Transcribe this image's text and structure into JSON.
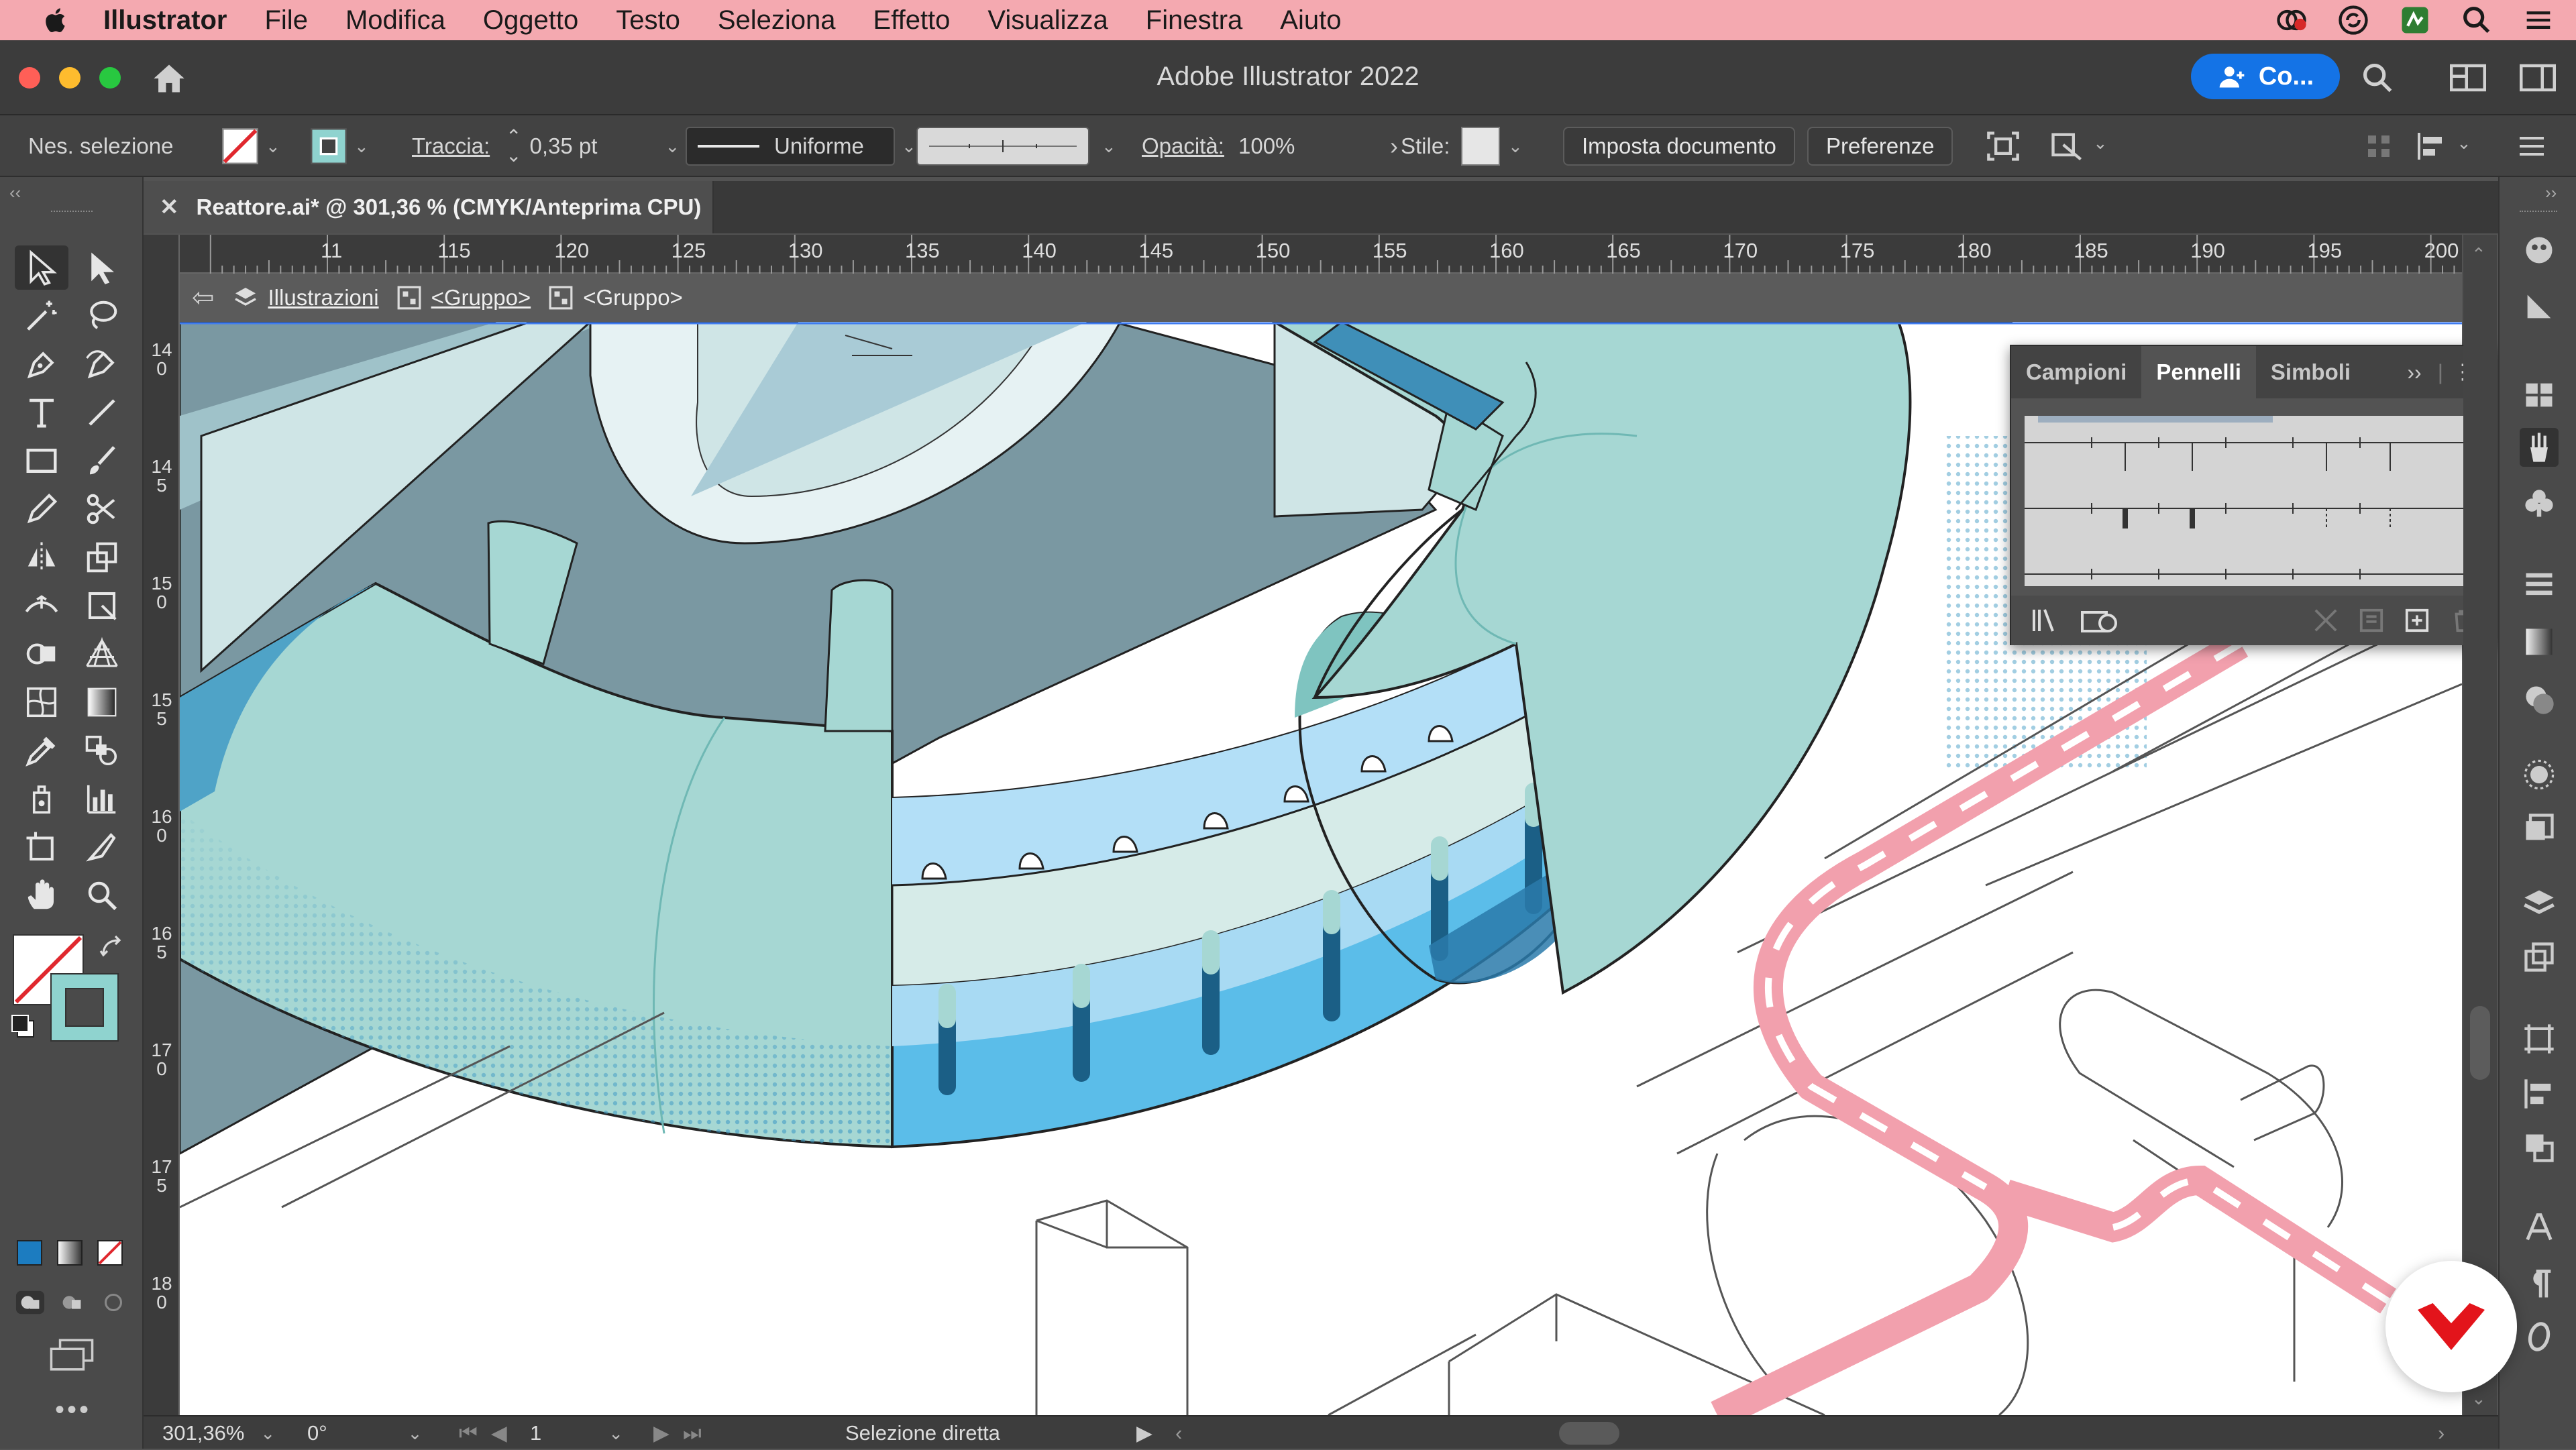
{
  "menubar": {
    "app_name": "Illustrator",
    "items": [
      "File",
      "Modifica",
      "Oggetto",
      "Testo",
      "Seleziona",
      "Effetto",
      "Visualizza",
      "Finestra",
      "Aiuto"
    ]
  },
  "titlebar": {
    "title": "Adobe Illustrator 2022",
    "cloud_button": "Co..."
  },
  "control_bar": {
    "selection_label": "Nes. selezione",
    "stroke_label": "Traccia:",
    "stroke_value": "0,35 pt",
    "profile_label": "Uniforme",
    "opacity_label": "Opacità:",
    "opacity_value": "100%",
    "style_label": "Stile:",
    "doc_setup_button": "Imposta documento",
    "prefs_button": "Preferenze"
  },
  "document": {
    "tab_title": "Reattore.ai* @ 301,36 % (CMYK/Anteprima CPU)"
  },
  "ruler": {
    "top_ticks": [
      "11",
      "115",
      "120",
      "125",
      "130",
      "135",
      "140",
      "145",
      "150",
      "155",
      "160",
      "165",
      "170",
      "175",
      "180",
      "185",
      "190",
      "195",
      "200"
    ],
    "left_ticks": [
      "140",
      "145",
      "150",
      "155",
      "160",
      "165",
      "170",
      "175",
      "180"
    ]
  },
  "breadcrumb": {
    "items": [
      "Illustrazioni",
      "<Gruppo>",
      "<Gruppo>"
    ]
  },
  "panel": {
    "tabs": [
      "Campioni",
      "Pennelli",
      "Simboli"
    ],
    "active_tab": "Pennelli"
  },
  "status": {
    "zoom": "301,36%",
    "rotation": "0°",
    "artboard": "1",
    "tool_name": "Selezione diretta"
  },
  "colors": {
    "menubar": "#f4a9b0",
    "accent": "#1473e6",
    "teal_light": "#a6d7d3",
    "teal_mid": "#7fc4c0",
    "blue_bright": "#5bbde9",
    "blue_pale": "#b3dff7",
    "slate": "#7a98a2",
    "pink_pipe": "#f2a0ad"
  }
}
